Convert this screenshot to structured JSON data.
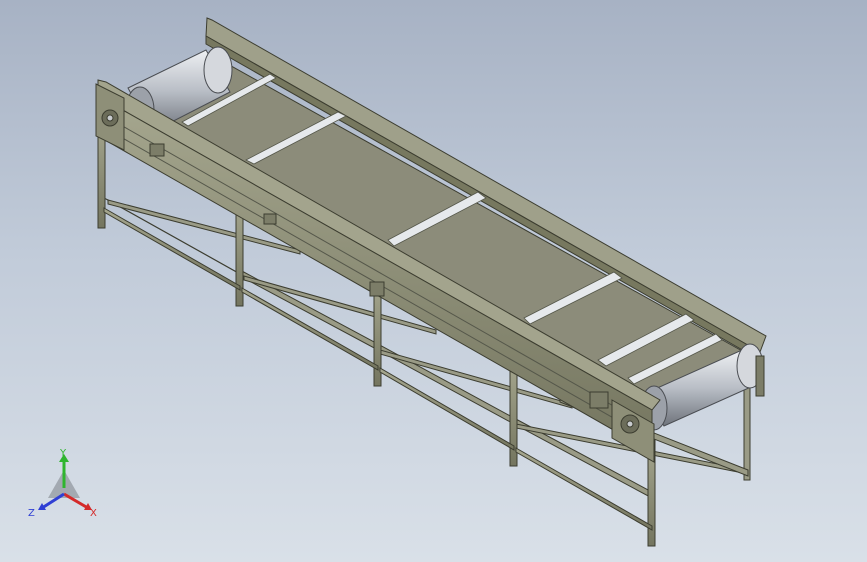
{
  "viewport": {
    "background_top": "#a7b2c4",
    "background_bottom": "#d9e0e8"
  },
  "model": {
    "frame_color": "#8f9079",
    "frame_edge": "#3c3d30",
    "belt_color": "#8c8c7a",
    "slat_color": "#e6e9ec",
    "roller_color": "#c8ccd2"
  },
  "triad": {
    "x_label": "X",
    "y_label": "Y",
    "z_label": "Z",
    "x_color": "#d42a2a",
    "y_color": "#2fb52f",
    "z_color": "#2f3fd4"
  }
}
